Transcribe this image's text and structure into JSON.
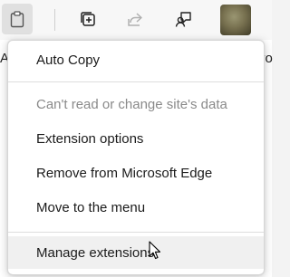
{
  "menu": {
    "items": [
      {
        "label": "Auto Copy"
      },
      {
        "label": "Can't read or change site's data"
      },
      {
        "label": "Extension options"
      },
      {
        "label": "Remove from Microsoft Edge"
      },
      {
        "label": "Move to the menu"
      },
      {
        "label": "Manage extensions"
      }
    ]
  },
  "page_fragments": {
    "left": "A",
    "right": "vo"
  },
  "toolbar": {
    "icons": [
      "clipboard-extension-icon",
      "collections-icon",
      "share-icon",
      "feedback-icon",
      "profile-avatar"
    ]
  }
}
